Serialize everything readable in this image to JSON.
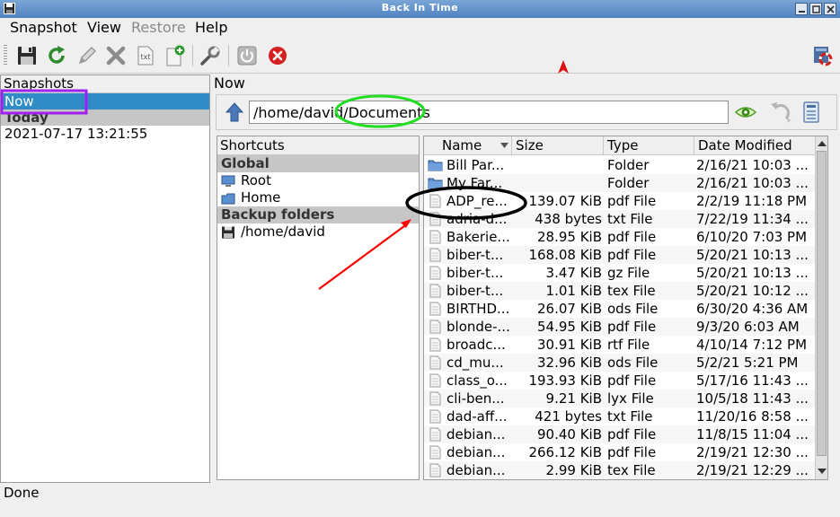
{
  "window": {
    "title": "Back In Time"
  },
  "menu": [
    {
      "label": "Snapshot",
      "enabled": true
    },
    {
      "label": "View",
      "enabled": true
    },
    {
      "label": "Restore",
      "enabled": false
    },
    {
      "label": "Help",
      "enabled": true
    }
  ],
  "snapshots": {
    "header": "Snapshots",
    "rows": [
      {
        "label": "Now",
        "kind": "selected"
      },
      {
        "label": "Today",
        "kind": "group"
      },
      {
        "label": "2021-07-17 13:21:55",
        "kind": "item"
      }
    ]
  },
  "view": {
    "current_label": "Now",
    "path": "/home/david/Documents"
  },
  "shortcuts": {
    "header": "Shortcuts",
    "global_label": "Global",
    "global_items": [
      {
        "label": "Root",
        "icon": "computer-icon"
      },
      {
        "label": "Home",
        "icon": "home-icon"
      }
    ],
    "backup_label": "Backup folders",
    "backup_items": [
      {
        "label": "/home/david",
        "icon": "floppy-icon"
      }
    ]
  },
  "files": {
    "columns": [
      "Name",
      "Size",
      "Type",
      "Date Modified"
    ],
    "rows": [
      {
        "name": "Bill Par...",
        "size": "",
        "type": "Folder",
        "date": "2/16/21 10:03 ...",
        "icon": "folder"
      },
      {
        "name": "My Far...",
        "size": "",
        "type": "Folder",
        "date": "2/16/21 10:03 ...",
        "icon": "folder"
      },
      {
        "name": "ADP_re...",
        "size": "139.07 KiB",
        "type": "pdf File",
        "date": "2/2/19 11:18 PM",
        "icon": "file"
      },
      {
        "name": "adria-d...",
        "size": "438 bytes",
        "type": "txt File",
        "date": "7/22/19 11:34 ...",
        "icon": "file"
      },
      {
        "name": "Bakerie...",
        "size": "28.95 KiB",
        "type": "pdf File",
        "date": "6/10/20 7:03 PM",
        "icon": "file"
      },
      {
        "name": "biber-t...",
        "size": "168.08 KiB",
        "type": "pdf File",
        "date": "5/20/21 10:13 ...",
        "icon": "file"
      },
      {
        "name": "biber-t...",
        "size": "3.47 KiB",
        "type": "gz File",
        "date": "5/20/21 10:13 ...",
        "icon": "file"
      },
      {
        "name": "biber-t...",
        "size": "1.01 KiB",
        "type": "tex File",
        "date": "5/20/21 10:12 ...",
        "icon": "file"
      },
      {
        "name": "BIRTHD...",
        "size": "26.07 KiB",
        "type": "ods File",
        "date": "6/30/20 4:36 AM",
        "icon": "file"
      },
      {
        "name": "blonde-...",
        "size": "54.95 KiB",
        "type": "pdf File",
        "date": "9/3/20 6:03 AM",
        "icon": "file"
      },
      {
        "name": "broadc...",
        "size": "30.91 KiB",
        "type": "rtf File",
        "date": "4/10/14 7:12 PM",
        "icon": "file"
      },
      {
        "name": "cd_mu...",
        "size": "32.96 KiB",
        "type": "ods File",
        "date": "5/2/21 5:21 PM",
        "icon": "file"
      },
      {
        "name": "class_o...",
        "size": "193.93 KiB",
        "type": "pdf File",
        "date": "5/17/16 11:43 ...",
        "icon": "file"
      },
      {
        "name": "cli-ben...",
        "size": "9.21 KiB",
        "type": "lyx File",
        "date": "10/5/18 11:43 ...",
        "icon": "file"
      },
      {
        "name": "dad-aff...",
        "size": "421 bytes",
        "type": "txt File",
        "date": "11/20/16 8:58 ...",
        "icon": "file"
      },
      {
        "name": "debian...",
        "size": "90.40 KiB",
        "type": "pdf File",
        "date": "11/8/15 11:04 ...",
        "icon": "file"
      },
      {
        "name": "debian...",
        "size": "266.12 KiB",
        "type": "pdf File",
        "date": "2/19/21 12:30 ...",
        "icon": "file"
      },
      {
        "name": "debian...",
        "size": "2.99 KiB",
        "type": "tex File",
        "date": "2/19/21 12:29 ...",
        "icon": "file"
      }
    ]
  },
  "status": {
    "text": "Done"
  },
  "colors": {
    "selection": "#308cc6",
    "annotation_red": "#ff0000",
    "annotation_green": "#22dd22",
    "annotation_purple": "#a020f0"
  }
}
